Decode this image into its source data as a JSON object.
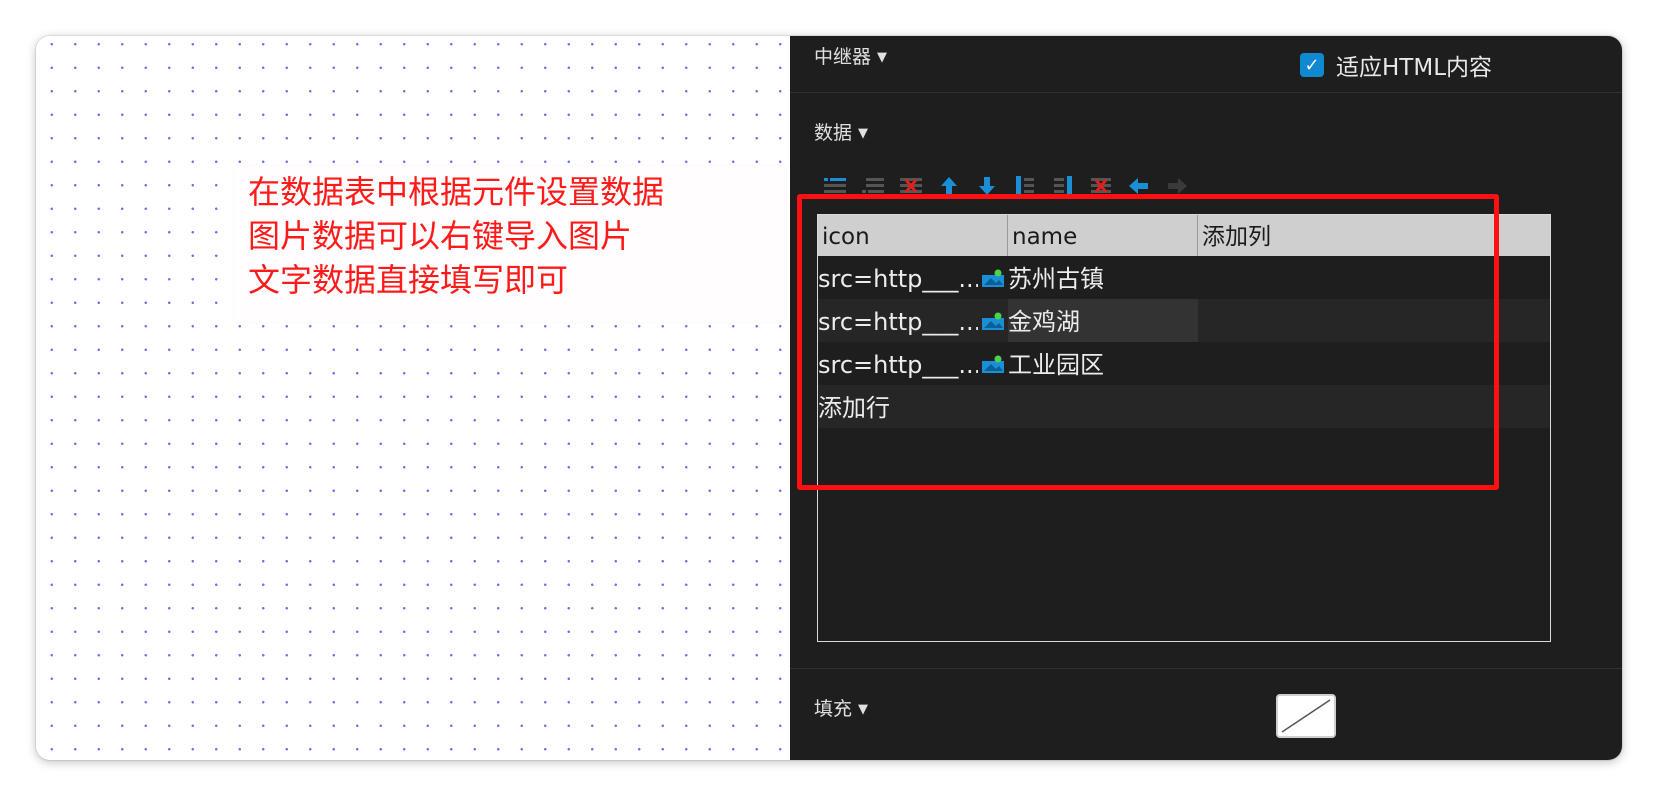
{
  "annotation": {
    "lines": [
      "在数据表中根据元件设置数据",
      "图片数据可以右键导入图片",
      "文字数据直接填写即可"
    ]
  },
  "panel": {
    "repeater_label": "中继器",
    "fit_html_label": "适应HTML内容",
    "fit_html_checked": true,
    "data_label": "数据",
    "fill_label": "填充"
  },
  "toolbar": {
    "icons": [
      "insert-row-above-icon",
      "insert-row-below-icon",
      "delete-row-icon",
      "move-up-icon",
      "move-down-icon",
      "insert-column-left-icon",
      "insert-column-right-icon",
      "delete-column-icon",
      "move-left-icon",
      "move-right-icon"
    ]
  },
  "table": {
    "columns": [
      "icon",
      "name",
      "添加列"
    ],
    "rows": [
      {
        "icon": "src=http___...",
        "name": "苏州古镇"
      },
      {
        "icon": "src=http___...",
        "name": "金鸡湖"
      },
      {
        "icon": "src=http___...",
        "name": "工业园区"
      }
    ],
    "add_row_label": "添加行"
  },
  "colors": {
    "annotation_red": "#ff1a1a",
    "panel_bg": "#1e1e1e",
    "accent_blue": "#0f8ad0",
    "highlight_red": "#ff1010"
  }
}
